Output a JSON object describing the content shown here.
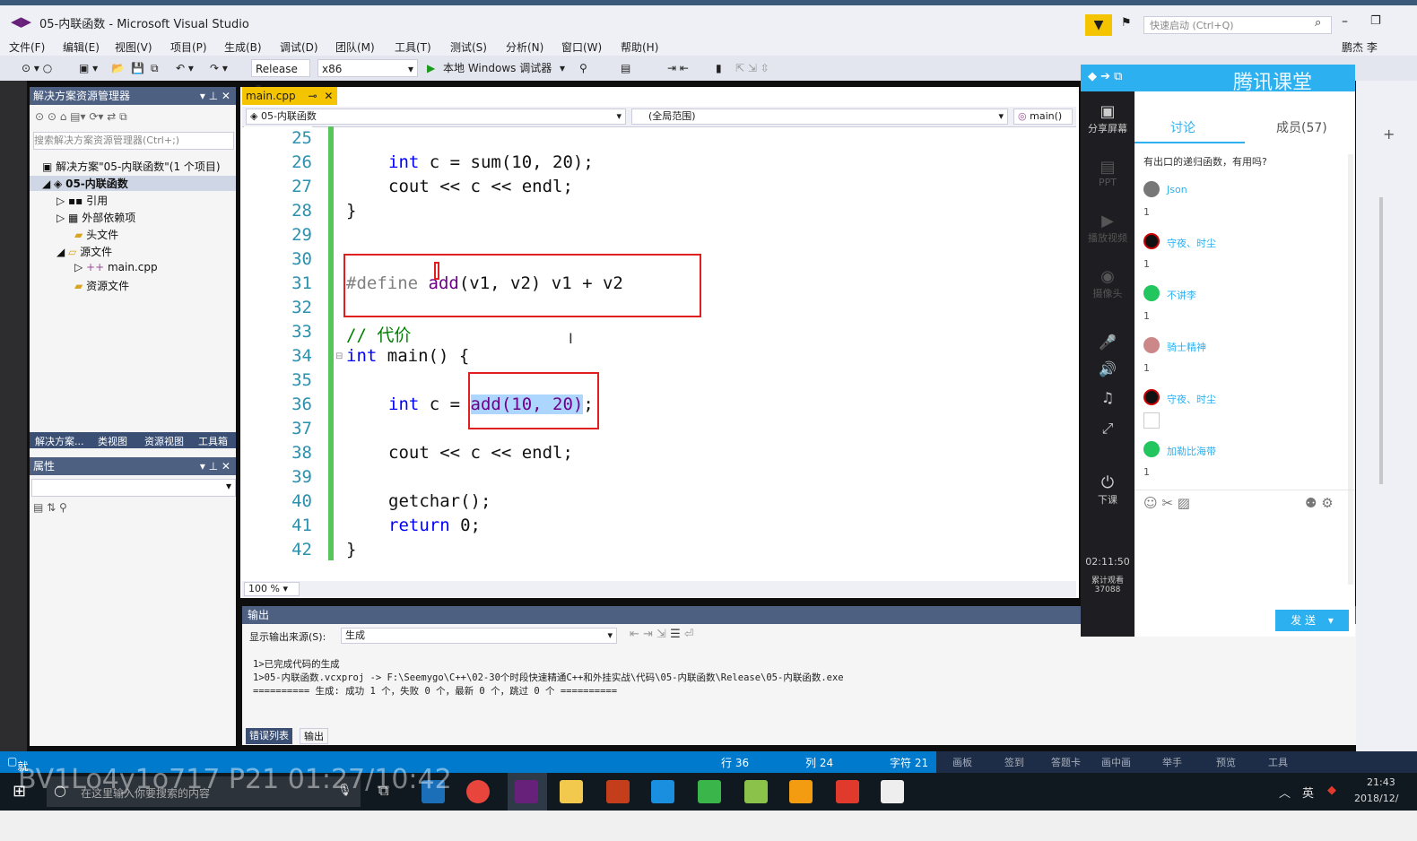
{
  "window": {
    "title": "05-内联函数 - Microsoft Visual Studio",
    "quick_launch_placeholder": "快速启动 (Ctrl+Q)",
    "user": "鹏杰 李"
  },
  "menu": [
    "文件(F)",
    "编辑(E)",
    "视图(V)",
    "项目(P)",
    "生成(B)",
    "调试(D)",
    "团队(M)",
    "工具(T)",
    "测试(S)",
    "分析(N)",
    "窗口(W)",
    "帮助(H)"
  ],
  "toolbar": {
    "config": "Release",
    "platform": "x86",
    "run_label": "本地 Windows 调试器"
  },
  "solution_explorer": {
    "title": "解决方案资源管理器",
    "search_placeholder": "搜索解决方案资源管理器(Ctrl+;)",
    "items": [
      "解决方案\"05-内联函数\"(1 个项目)",
      "05-内联函数",
      "引用",
      "外部依赖项",
      "头文件",
      "源文件",
      "main.cpp",
      "资源文件"
    ],
    "bottom_tabs": [
      "解决方案...",
      "类视图",
      "资源视图",
      "工具箱"
    ]
  },
  "properties": {
    "title": "属性"
  },
  "editor": {
    "tab": "main.cpp",
    "nav_project": "05-内联函数",
    "nav_scope": "(全局范围)",
    "nav_member": "main()",
    "zoom": "100 %",
    "line_numbers": [
      "25",
      "26",
      "27",
      "28",
      "29",
      "30",
      "31",
      "32",
      "33",
      "34",
      "35",
      "36",
      "37",
      "38",
      "39",
      "40",
      "41",
      "42"
    ],
    "code": {
      "l26_kw": "int",
      "l26_rest": " c = sum(10, 20);",
      "l27": "cout << c << endl;",
      "l28": "}",
      "l31_pp": "#define ",
      "l31_mac": "add",
      "l31_rest": "(v1, v2) v1 + v2",
      "l33": "// 代价",
      "l34_kw": "int",
      "l34_rest": " main() {",
      "l36_kw": "int",
      "l36_mid": " c = ",
      "l36_sel": "add(10, 20)",
      "l36_end": ";",
      "l38": "cout << c << endl;",
      "l40": "getchar();",
      "l41_kw": "return",
      "l41_rest": " 0;",
      "l42": "}"
    }
  },
  "output": {
    "title": "输出",
    "source_label": "显示输出来源(S):",
    "source_value": "生成",
    "lines": [
      "1>已完成代码的生成",
      "1>05-内联函数.vcxproj -> F:\\Seemygo\\C++\\02-30个时段快速精通C++和外挂实战\\代码\\05-内联函数\\Release\\05-内联函数.exe",
      "========== 生成: 成功 1 个，失败 0 个，最新 0 个，跳过 0 个 =========="
    ],
    "bottom_tabs": [
      "错误列表",
      "输出"
    ]
  },
  "status": {
    "state": "就绪",
    "line": "行 36",
    "col": "列 24",
    "char": "字符 21",
    "extras": [
      "画板",
      "签到",
      "答题卡",
      "画中画",
      "举手",
      "预览",
      "工具"
    ]
  },
  "qq_class": {
    "brand": "腾讯课堂",
    "tabs": [
      "讨论",
      "成员(57)"
    ],
    "side": [
      "分享屏幕",
      "PPT",
      "播放视频",
      "摄像头",
      "下课"
    ],
    "timer": "02:11:50",
    "viewers": "累计观看 37088",
    "messages": [
      {
        "text": "有出口的递归函数，有用吗?"
      },
      {
        "name": "Json",
        "text": "1"
      },
      {
        "name": "守夜、时尘",
        "text": "1"
      },
      {
        "name": "不讲李",
        "text": "1"
      },
      {
        "name": "骑士精神",
        "text": "1"
      },
      {
        "name": "守夜、时尘",
        "text": ""
      },
      {
        "name": "加勒比海带",
        "text": "1"
      }
    ],
    "send": "发 送"
  },
  "taskbar": {
    "search_placeholder": "在这里输入你要搜索的内容",
    "time": "21:43",
    "date": "2018/12/",
    "ime": "英"
  },
  "overlay": {
    "watermark": "BV1Lo4y1o717 P21 01:27/10:42"
  },
  "colors": {
    "accent": "#007acc",
    "highlight_box": "#e02020",
    "keyword": "#0000ff",
    "macro": "#6f008a",
    "comment": "#008000"
  }
}
